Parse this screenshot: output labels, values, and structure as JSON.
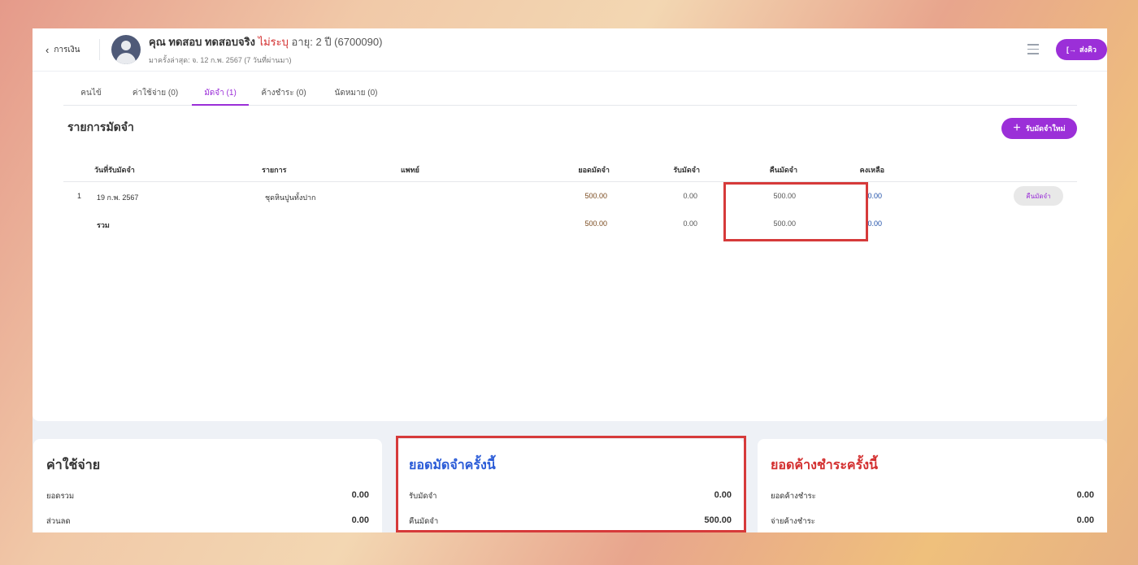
{
  "header": {
    "back_label": "การเงิน",
    "patient_prefix": "คุณ ทดสอบ ทดสอบจริง",
    "gender": "ไม่ระบุ",
    "age_info": "อายุ: 2 ปี (6700090)",
    "last_visit": "มาครั้งล่าสุด: จ. 12 ก.พ. 2567 (7 วันที่ผ่านมา)",
    "queue_button": "ส่งคิว"
  },
  "tabs": [
    {
      "label": "คนไข้"
    },
    {
      "label": "ค่าใช้จ่าย (0)"
    },
    {
      "label": "มัดจำ (1)"
    },
    {
      "label": "ค้างชำระ (0)"
    },
    {
      "label": "นัดหมาย (0)"
    }
  ],
  "deposit": {
    "title": "รายการมัดจำ",
    "add_button": "รับมัดจำใหม่",
    "columns": [
      "วันที่รับมัดจำ",
      "รายการ",
      "แพทย์",
      "ยอดมัดจำ",
      "รับมัดจำ",
      "คืนมัดจำ",
      "คงเหลือ"
    ],
    "rows": [
      {
        "no": "1",
        "date": "19 ก.พ. 2567",
        "item": "ชุดหินปูนทั้งปาก",
        "doctor": "",
        "amount": "500.00",
        "received": "0.00",
        "returned": "500.00",
        "balance": "0.00",
        "action": "คืนมัดจำ"
      }
    ],
    "total": {
      "label": "รวม",
      "amount": "500.00",
      "received": "0.00",
      "returned": "500.00",
      "balance": "0.00"
    }
  },
  "summary": [
    {
      "title": "ค่าใช้จ่าย",
      "color": "#333333",
      "lines": [
        {
          "label": "ยอดรวม",
          "value": "0.00"
        },
        {
          "label": "ส่วนลด",
          "value": "0.00"
        }
      ]
    },
    {
      "title": "ยอดมัดจำครั้งนี้",
      "color": "#2a5bd7",
      "lines": [
        {
          "label": "รับมัดจำ",
          "value": "0.00"
        },
        {
          "label": "คืนมัดจำ",
          "value": "500.00"
        }
      ]
    },
    {
      "title": "ยอดค้างชำระครั้งนี้",
      "color": "#d32f2f",
      "lines": [
        {
          "label": "ยอดค้างชำระ",
          "value": "0.00"
        },
        {
          "label": "จ่ายค้างชำระ",
          "value": "0.00"
        }
      ]
    }
  ]
}
